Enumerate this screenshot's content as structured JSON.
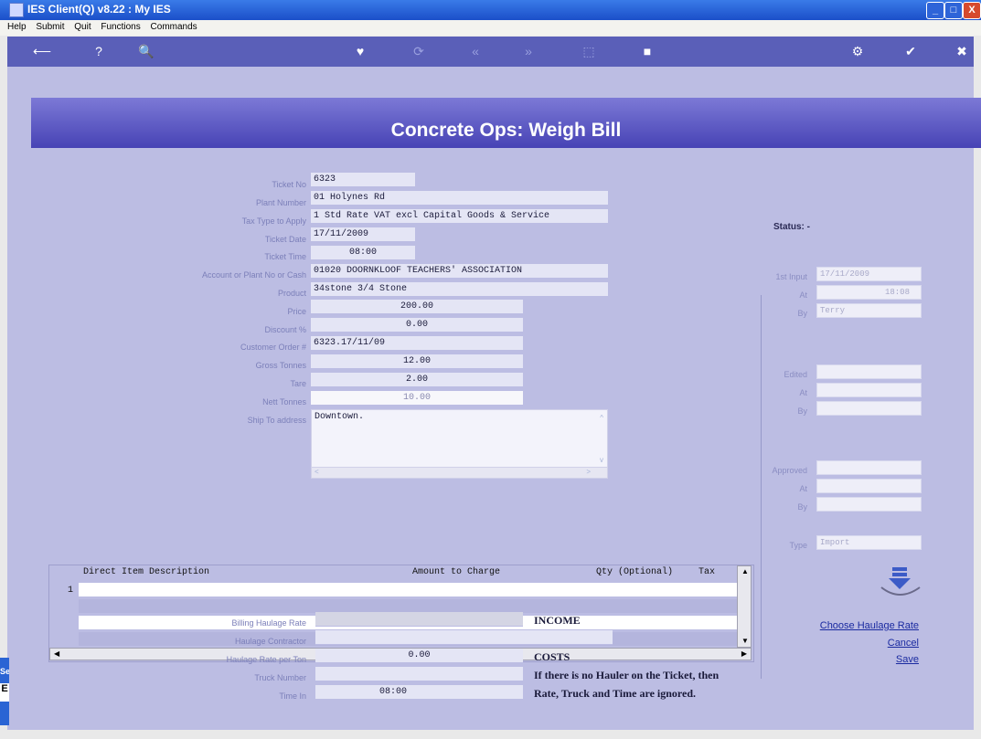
{
  "window": {
    "title": "IES Client(Q) v8.22 : My IES",
    "min": "_",
    "max": "□",
    "close": "X"
  },
  "menu": [
    "Help",
    "Submit",
    "Quit",
    "Functions",
    "Commands"
  ],
  "toolbar": [
    "⟵",
    "?",
    "🔍",
    "♥",
    "⟳",
    "«",
    "»",
    "⬚",
    "■",
    "⚙",
    "✔",
    "✖"
  ],
  "header": {
    "title": "Concrete Ops: Weigh Bill"
  },
  "form": {
    "ticket_no": {
      "label": "Ticket No",
      "value": "6323"
    },
    "plant_number": {
      "label": "Plant Number",
      "value": "01 Holynes Rd"
    },
    "tax_type": {
      "label": "Tax Type to Apply",
      "value": "1 Std Rate VAT excl Capital Goods & Service"
    },
    "ticket_date": {
      "label": "Ticket Date",
      "value": "17/11/2009"
    },
    "ticket_time": {
      "label": "Ticket Time",
      "value": "08:00"
    },
    "account": {
      "label": "Account or Plant No or Cash",
      "value": "01020 DOORNKLOOF TEACHERS' ASSOCIATION"
    },
    "product": {
      "label": "Product",
      "value": "34stone 3/4 Stone"
    },
    "price": {
      "label": "Price",
      "value": "200.00"
    },
    "discount": {
      "label": "Discount %",
      "value": "0.00"
    },
    "customer_order": {
      "label": "Customer Order #",
      "value": "6323.17/11/09"
    },
    "gross_tonnes": {
      "label": "Gross Tonnes",
      "value": "12.00"
    },
    "tare": {
      "label": "Tare",
      "value": "2.00"
    },
    "nett_tonnes": {
      "label": "Nett Tonnes",
      "value": "10.00"
    },
    "ship_to": {
      "label": "Ship To address",
      "value": "Downtown."
    }
  },
  "grid": {
    "headers": {
      "desc": "Direct Item Description",
      "amount": "Amount to Charge",
      "qty": "Qty (Optional)",
      "tax": "Tax"
    },
    "row_number": "1"
  },
  "status": {
    "label": "Status: -",
    "first_input": {
      "label": "1st Input",
      "date": "17/11/2009",
      "at_label": "At",
      "time": "18:08",
      "by_label": "By",
      "by": "Terry"
    },
    "edited": {
      "label": "Edited",
      "at_label": "At",
      "by_label": "By"
    },
    "approved": {
      "label": "Approved",
      "at_label": "At",
      "by_label": "By"
    },
    "type": {
      "label": "Type",
      "value": "Import"
    }
  },
  "haulage": {
    "billing_rate": {
      "label": "Billing Haulage Rate"
    },
    "contractor": {
      "label": "Haulage Contractor"
    },
    "rate_per_ton": {
      "label": "Haulage Rate per Ton",
      "value": "0.00"
    },
    "truck_number": {
      "label": "Truck Number"
    },
    "time_in": {
      "label": "Time In",
      "value": "08:00"
    },
    "income": "INCOME",
    "costs": "COSTS",
    "note1": "If there is no Hauler on the Ticket, then",
    "note2": "Rate, Truck and Time are ignored."
  },
  "actions": {
    "choose_rate": "Choose Haulage Rate",
    "cancel": "Cancel",
    "save": "Save"
  },
  "side_tab": {
    "text": "Se",
    "glyph": "E"
  },
  "colors": {
    "header": "#5a55c4",
    "toolbar": "#5a5fb8",
    "background": "#bcbde3"
  }
}
